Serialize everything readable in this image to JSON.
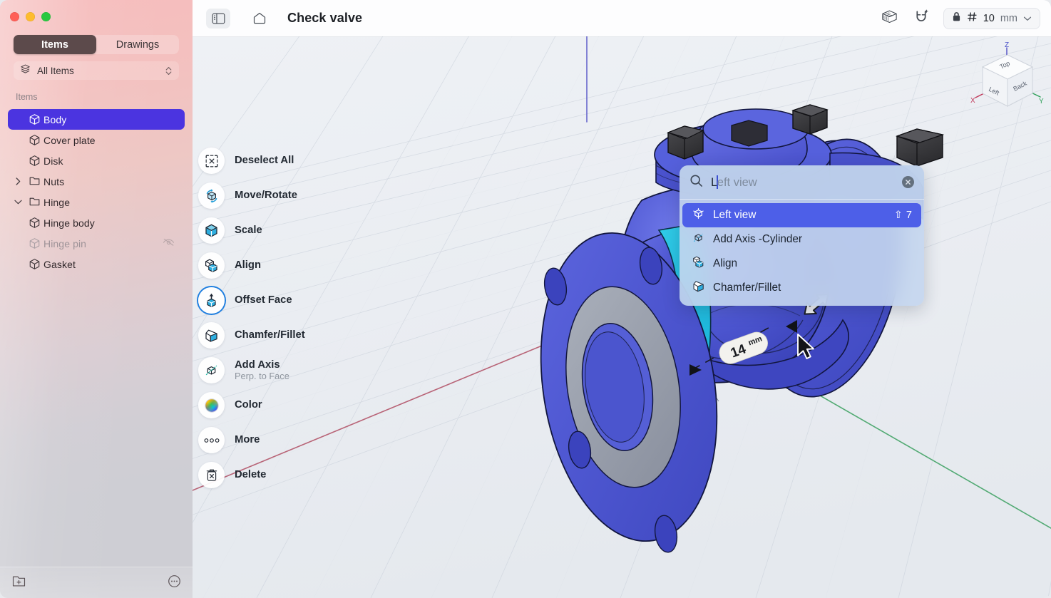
{
  "window": {
    "traffic_lights": [
      "close",
      "minimize",
      "zoom"
    ]
  },
  "sidebar": {
    "tabs": [
      {
        "label": "Items",
        "active": true
      },
      {
        "label": "Drawings",
        "active": false
      }
    ],
    "filter": {
      "label": "All Items",
      "icon": "stack-icon"
    },
    "section_header": "Items",
    "tree": [
      {
        "label": "Body",
        "icon": "cube-icon",
        "selected": true,
        "indent": 0,
        "twisty": "",
        "hidden": false
      },
      {
        "label": "Cover plate",
        "icon": "cube-icon",
        "selected": false,
        "indent": 0,
        "twisty": "",
        "hidden": false
      },
      {
        "label": "Disk",
        "icon": "cube-icon",
        "selected": false,
        "indent": 0,
        "twisty": "",
        "hidden": false
      },
      {
        "label": "Nuts",
        "icon": "folder-icon",
        "selected": false,
        "indent": 0,
        "twisty": "right",
        "hidden": false
      },
      {
        "label": "Hinge",
        "icon": "folder-icon",
        "selected": false,
        "indent": 0,
        "twisty": "down",
        "hidden": false
      },
      {
        "label": "Hinge body",
        "icon": "cube-icon",
        "selected": false,
        "indent": 1,
        "twisty": "",
        "hidden": false
      },
      {
        "label": "Hinge pin",
        "icon": "cube-icon",
        "selected": false,
        "indent": 1,
        "twisty": "",
        "hidden": true
      },
      {
        "label": "Gasket",
        "icon": "cube-icon",
        "selected": false,
        "indent": 0,
        "twisty": "",
        "hidden": false
      }
    ],
    "footer": {
      "add_folder_icon": "add-folder-icon",
      "more_icon": "more-circle-icon"
    },
    "selected_color": "#4b34e0",
    "active_tab_color": "#5c4a4b"
  },
  "topbar": {
    "sidebar_toggle_icon": "sidebar-toggle-icon",
    "home_icon": "home-icon",
    "title": "Check valve",
    "material_icon": "material-icon",
    "magnet_icon": "magnet-snap-icon",
    "units": {
      "lock_icon": "lock-icon",
      "grid_icon": "grid-hash-icon",
      "value": "10",
      "unit": "mm",
      "chevron": "chevron-down-icon"
    }
  },
  "palette": {
    "tools": [
      {
        "label": "Deselect All",
        "sub": "",
        "icon": "deselect-icon",
        "active": false
      },
      {
        "label": "Move/Rotate",
        "sub": "",
        "icon": "move-rotate-icon",
        "active": false
      },
      {
        "label": "Scale",
        "sub": "",
        "icon": "scale-icon",
        "active": false
      },
      {
        "label": "Align",
        "sub": "",
        "icon": "align-icon",
        "active": false
      },
      {
        "label": "Offset Face",
        "sub": "",
        "icon": "offset-face-icon",
        "active": true
      },
      {
        "label": "Chamfer/Fillet",
        "sub": "",
        "icon": "chamfer-icon",
        "active": false
      },
      {
        "label": "Add Axis",
        "sub": "Perp. to Face",
        "icon": "add-axis-icon",
        "active": false
      },
      {
        "label": "Color",
        "sub": "",
        "icon": "color-wheel-icon",
        "active": false
      },
      {
        "label": "More",
        "sub": "",
        "icon": "more-dots-icon",
        "active": false
      },
      {
        "label": "Delete",
        "sub": "",
        "icon": "trash-icon",
        "active": false
      }
    ]
  },
  "search_popup": {
    "search_icon": "search-icon",
    "typed_text": "L",
    "ghost_text": "eft view",
    "placeholder": "Search",
    "clear_icon": "clear-circle-icon",
    "results": [
      {
        "label": "Left view",
        "icon": "view-cube-icon",
        "shortcut_modifier": "⇧",
        "shortcut_key": "7",
        "highlighted": true
      },
      {
        "label": "Add Axis -Cylinder",
        "icon": "axis-cube-icon",
        "shortcut_modifier": "",
        "shortcut_key": "",
        "highlighted": false
      },
      {
        "label": "Align",
        "icon": "align-cubes-icon",
        "shortcut_modifier": "",
        "shortcut_key": "",
        "highlighted": false
      },
      {
        "label": "Chamfer/Fillet",
        "icon": "chamfer-cube-icon",
        "shortcut_modifier": "",
        "shortcut_key": "",
        "highlighted": false
      }
    ],
    "highlight_color": "#4d5fe8"
  },
  "viewport": {
    "dimension_label": {
      "value": "14",
      "unit": "mm"
    },
    "view_cube": {
      "faces": [
        "Top",
        "Left",
        "Back"
      ],
      "axes": [
        {
          "name": "X",
          "color": "#c0395a"
        },
        {
          "name": "Y",
          "color": "#2fa05a"
        },
        {
          "name": "Z",
          "color": "#4a52c8"
        }
      ]
    },
    "model": {
      "name": "Check valve",
      "body_color": "#4a53cf",
      "highlight_face_color": "#2ec4e0",
      "gasket_color": "#9aa0ae",
      "nut_color": "#3a3a3c"
    },
    "background_color": "#eceff3",
    "grid_color": "#dfe3e9"
  }
}
